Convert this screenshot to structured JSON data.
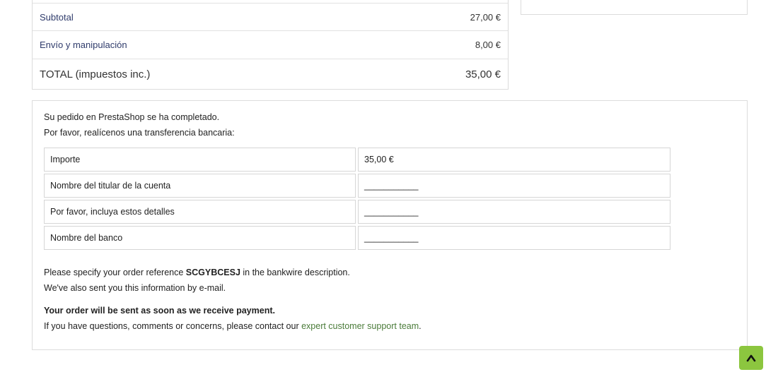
{
  "totals": {
    "rows": [
      {
        "label": "Subtotal",
        "value": "27,00 €"
      },
      {
        "label": "Envío y manipulación",
        "value": "8,00 €"
      },
      {
        "label": "TOTAL (impuestos inc.)",
        "value": "35,00 €"
      }
    ]
  },
  "confirmation": {
    "line1": "Su pedido en PrestaShop se ha completado.",
    "line2": "Por favor, realícenos una transferencia bancaria:",
    "bank_rows": [
      {
        "label": "Importe",
        "value": "35,00 €"
      },
      {
        "label": "Nombre del titular de la cuenta",
        "value": "___________"
      },
      {
        "label": "Por favor, incluya estos detalles",
        "value": "___________"
      },
      {
        "label": "Nombre del banco",
        "value": "___________"
      }
    ],
    "reference_prefix": "Please specify your order reference ",
    "reference_code": "SCGYBCESJ",
    "reference_suffix": " in the bankwire description.",
    "email_note": "We've also sent you this information by e-mail.",
    "shipping_note": "Your order will be sent as soon as we receive payment.",
    "support_prefix": "If you have questions, comments or concerns, please contact our ",
    "support_link": "expert customer support team",
    "support_suffix": "."
  },
  "scroll_top": {
    "icon": "chevron-up-icon",
    "color": "#8cc63f"
  }
}
